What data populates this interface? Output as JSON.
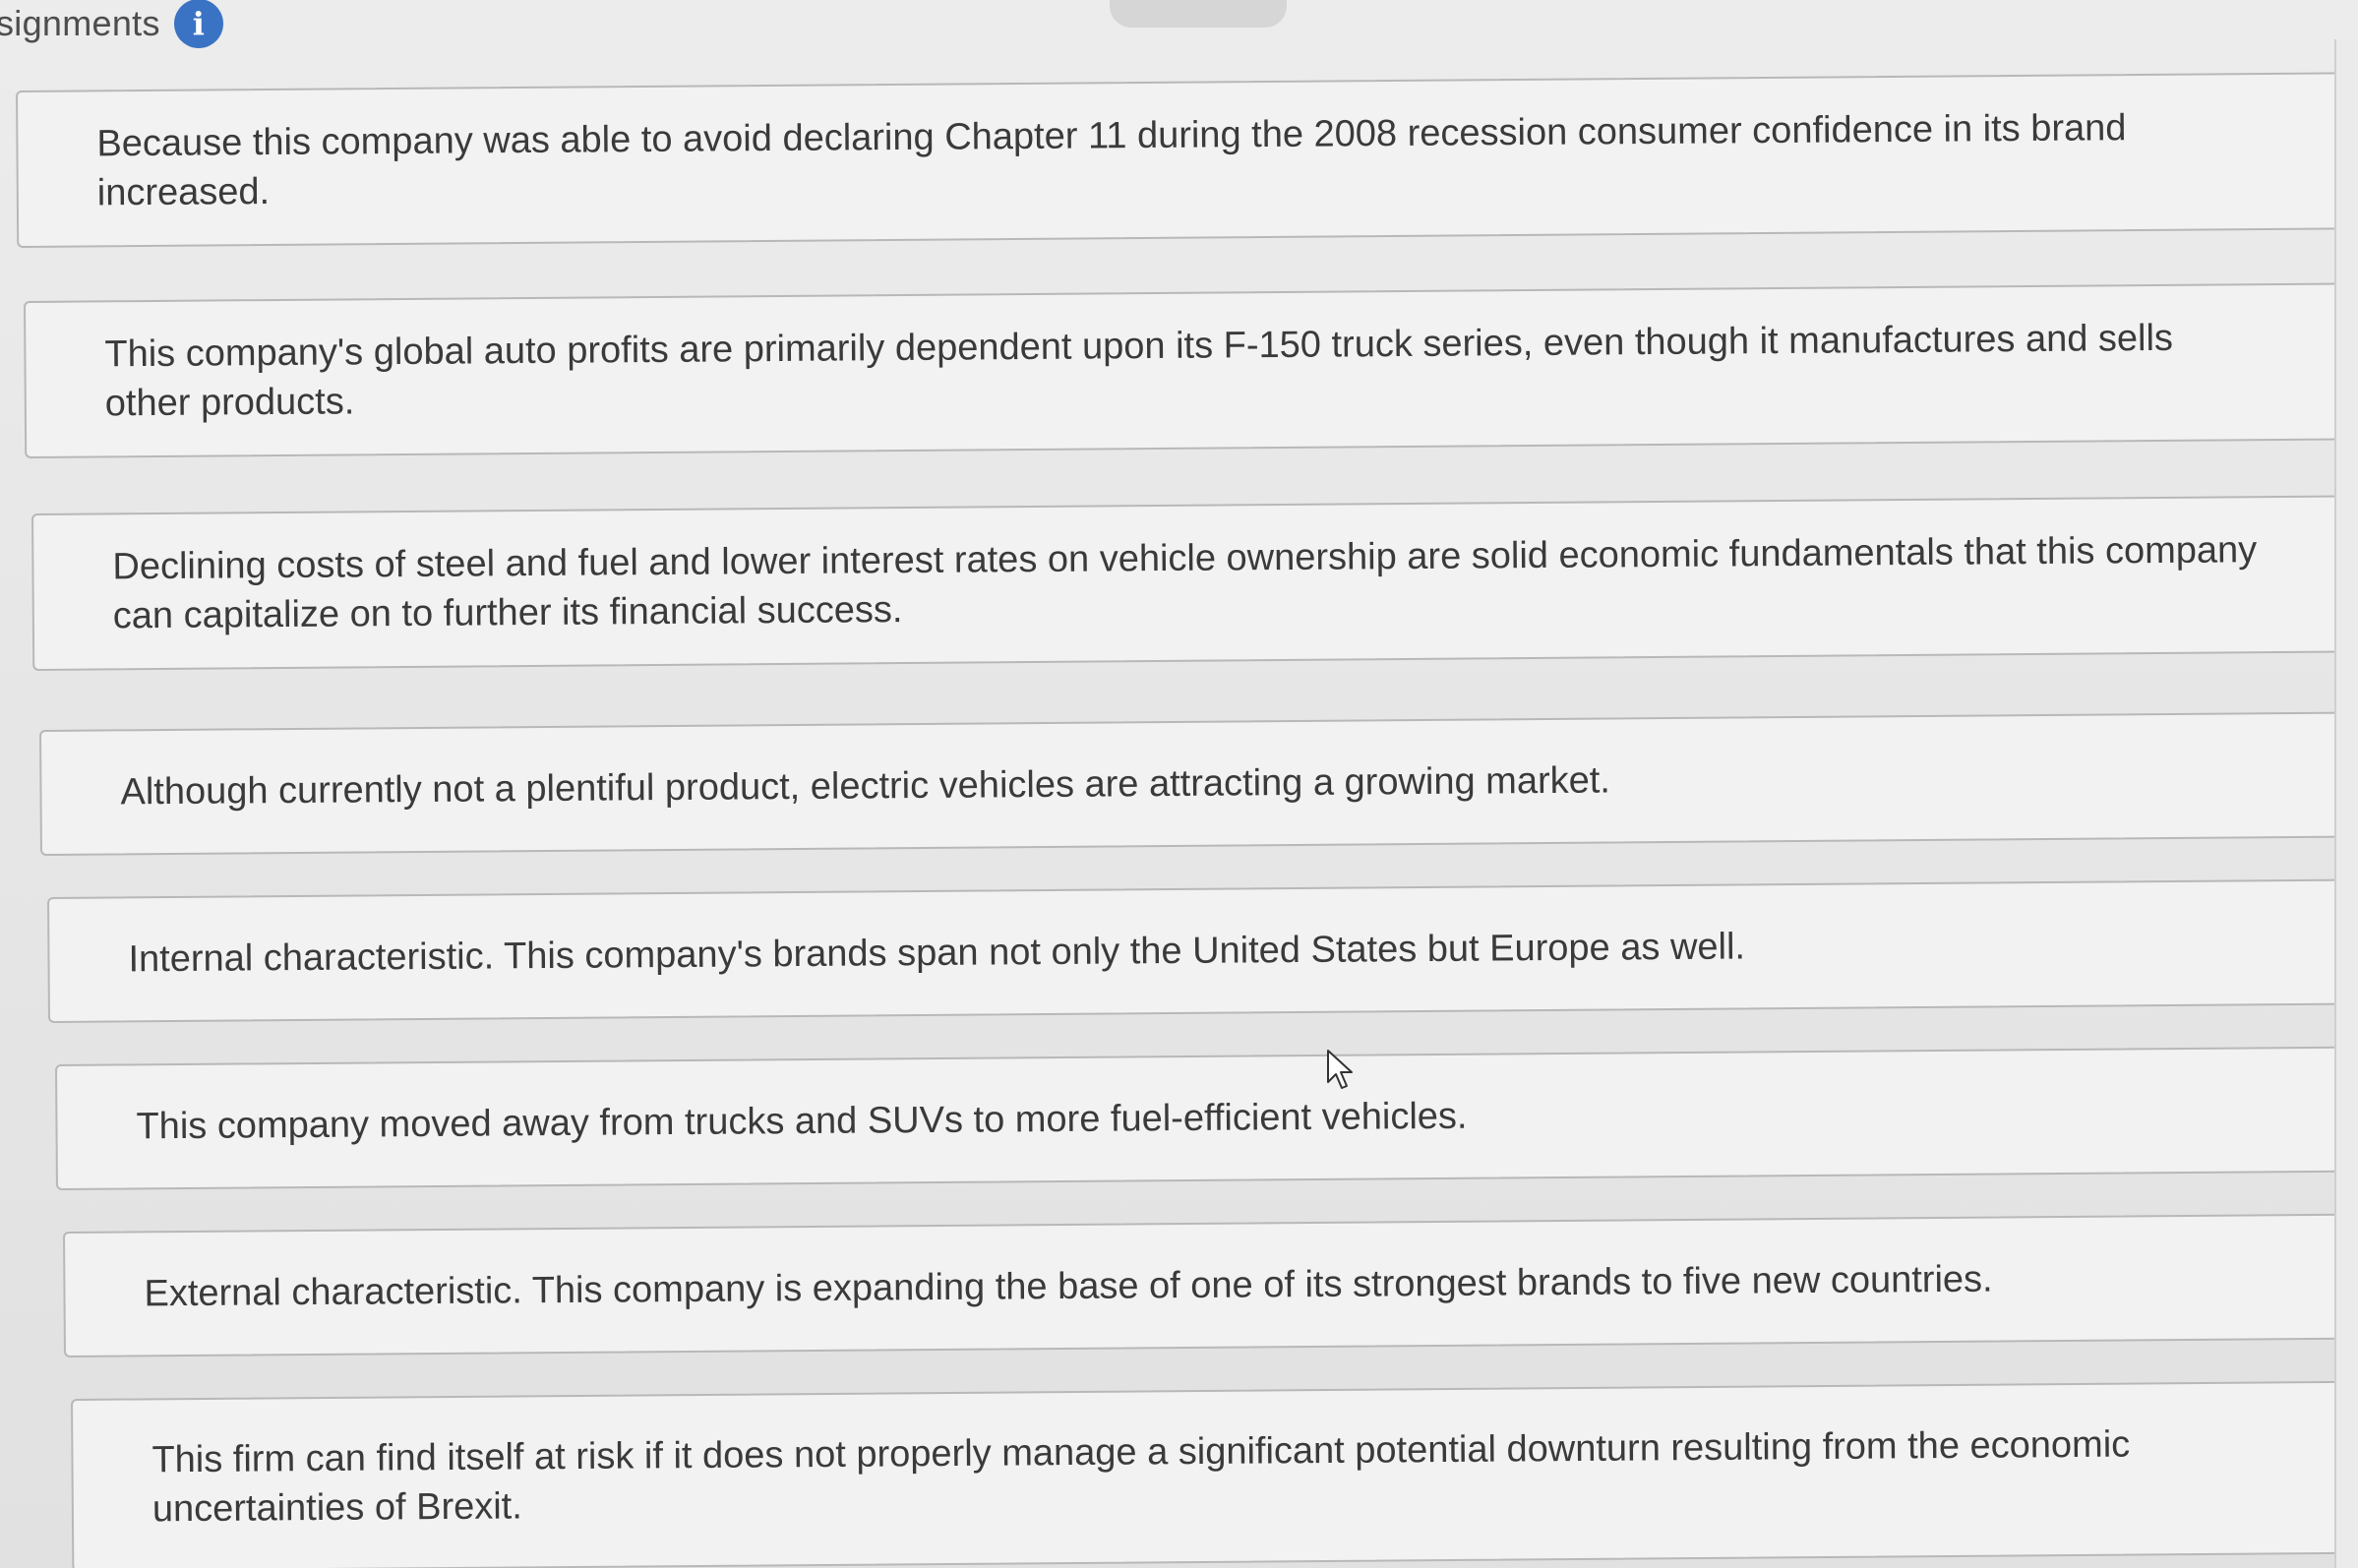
{
  "header": {
    "title": "signments",
    "info_icon": "info-icon"
  },
  "cards": [
    {
      "text": "Because this company was able to avoid declaring Chapter 11 during the 2008 recession consumer confidence in its brand increased."
    },
    {
      "text": "This company's global auto profits are primarily dependent upon its F-150 truck series, even though it manufactures and sells other products."
    },
    {
      "text": "Declining costs of steel and fuel and lower interest rates on vehicle ownership are solid economic fundamentals that this company can capitalize on to further its financial success."
    },
    {
      "text": "Although currently not a plentiful product, electric vehicles are attracting a growing market."
    },
    {
      "text": "Internal characteristic. This company's brands span not only the United States but Europe as well."
    },
    {
      "text": "This company moved away from trucks and SUVs to more fuel-efficient vehicles."
    },
    {
      "text": "External characteristic. This company is expanding the base of one of its strongest brands to five new countries."
    },
    {
      "text": "This firm can find itself at risk if it does not properly manage a significant potential downturn resulting from the economic uncertainties of Brexit."
    }
  ],
  "colors": {
    "info_icon": "#3b73c4",
    "card_background": "#f2f2f2",
    "card_border": "#b8b8b8",
    "text": "#3a3a3a"
  }
}
